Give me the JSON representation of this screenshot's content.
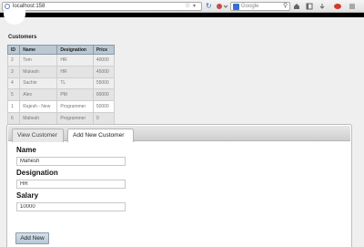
{
  "browser": {
    "url": "localhost:158",
    "search_placeholder": "Google"
  },
  "page": {
    "section_title": "Customers"
  },
  "table": {
    "headers": [
      "ID",
      "Name",
      "Designation",
      "Price"
    ],
    "rows": [
      [
        "2",
        "Tom",
        "HR",
        "40000"
      ],
      [
        "3",
        "Mukesh",
        "HR",
        "45000"
      ],
      [
        "4",
        "Sachin",
        "TL",
        "55000"
      ],
      [
        "5",
        "Alex",
        "PM",
        "60000"
      ],
      [
        "1",
        "Rajesh - New",
        "Programmer",
        "50000"
      ],
      [
        "6",
        "Mahesh",
        "Programmer",
        "0"
      ]
    ]
  },
  "tabs": [
    {
      "label": "View Customer",
      "active": false
    },
    {
      "label": "Add New Customer",
      "active": true
    }
  ],
  "form": {
    "name_label": "Name",
    "name_value": "Mahesh",
    "designation_label": "Designation",
    "designation_value": "HR",
    "salary_label": "Salary",
    "salary_value": "10000",
    "submit_label": "Add New"
  },
  "colors": {
    "table_header_bg": "#b9c8d3",
    "button_bg": "#c4d4df",
    "page_bg": "#efefef"
  }
}
